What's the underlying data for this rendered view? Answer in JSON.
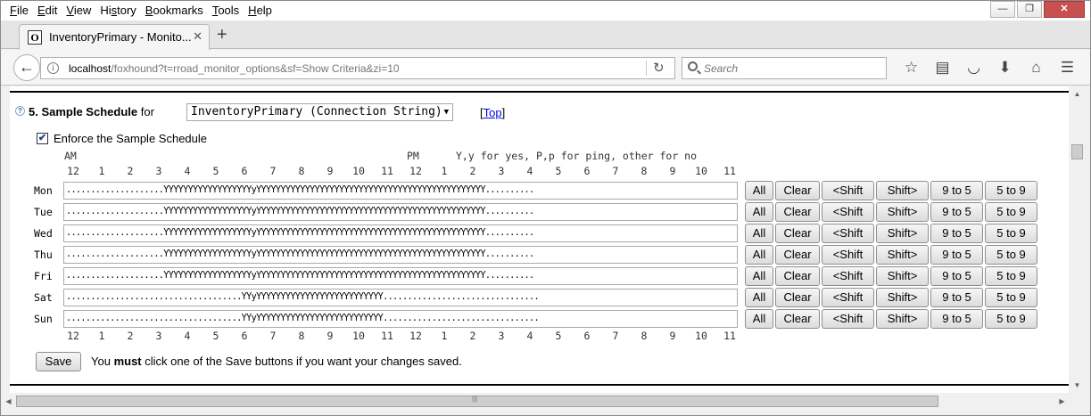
{
  "window": {
    "menu": [
      {
        "pre": "",
        "key": "F",
        "post": "ile"
      },
      {
        "pre": "",
        "key": "E",
        "post": "dit"
      },
      {
        "pre": "",
        "key": "V",
        "post": "iew"
      },
      {
        "pre": "Hi",
        "key": "s",
        "post": "tory"
      },
      {
        "pre": "",
        "key": "B",
        "post": "ookmarks"
      },
      {
        "pre": "",
        "key": "T",
        "post": "ools"
      },
      {
        "pre": "",
        "key": "H",
        "post": "elp"
      }
    ],
    "controls": {
      "minimize": "—",
      "restore": "❐",
      "close": "✕"
    }
  },
  "tabs": [
    {
      "title": "InventoryPrimary - Monito...",
      "favicon": "O",
      "close": "✕"
    }
  ],
  "newtab": "+",
  "nav": {
    "back": "←",
    "info": "i",
    "url_host": "localhost",
    "url_path": "/foxhound?t=rroad_monitor_options&sf=Show Criteria&zi=10",
    "reload": "↻",
    "search_placeholder": "Search",
    "icons": [
      {
        "name": "bookmark-star-icon",
        "glyph": "☆"
      },
      {
        "name": "reading-list-icon",
        "glyph": "▤"
      },
      {
        "name": "pocket-icon",
        "glyph": "◡"
      },
      {
        "name": "download-icon",
        "glyph": "⬇"
      },
      {
        "name": "home-icon",
        "glyph": "⌂"
      },
      {
        "name": "hamburger-menu-icon",
        "glyph": "☰"
      }
    ]
  },
  "section": {
    "help": "?",
    "number_title": "5. Sample Schedule",
    "for_label": "for",
    "dsn_selected": "InventoryPrimary (Connection String)",
    "top_bracket_open": "[",
    "top_link": "Top",
    "top_bracket_close": "]",
    "enforce_label": "Enforce the Sample Schedule",
    "enforce_checked": "✔"
  },
  "grid": {
    "am": "AM",
    "pm": "PM",
    "legend": "Y,y for yes, P,p for ping, other for no",
    "hours": [
      "12",
      "1",
      "2",
      "3",
      "4",
      "5",
      "6",
      "7",
      "8",
      "9",
      "10",
      "11",
      "12",
      "1",
      "2",
      "3",
      "4",
      "5",
      "6",
      "7",
      "8",
      "9",
      "10",
      "11"
    ],
    "days": [
      {
        "label": "Mon",
        "schedule": "....................YYYYYYYYYYYYYYYYYYyYYYYYYYYYYYYYYYYYYYYYYYYYYYYYYYYYYYYYYYYYYYYYYY.........."
      },
      {
        "label": "Tue",
        "schedule": "....................YYYYYYYYYYYYYYYYYYyYYYYYYYYYYYYYYYYYYYYYYYYYYYYYYYYYYYYYYYYYYYYYYY.........."
      },
      {
        "label": "Wed",
        "schedule": "....................YYYYYYYYYYYYYYYYYYyYYYYYYYYYYYYYYYYYYYYYYYYYYYYYYYYYYYYYYYYYYYYYYY.........."
      },
      {
        "label": "Thu",
        "schedule": "....................YYYYYYYYYYYYYYYYYYyYYYYYYYYYYYYYYYYYYYYYYYYYYYYYYYYYYYYYYYYYYYYYYY.........."
      },
      {
        "label": "Fri",
        "schedule": "....................YYYYYYYYYYYYYYYYYYyYYYYYYYYYYYYYYYYYYYYYYYYYYYYYYYYYYYYYYYYYYYYYYY.........."
      },
      {
        "label": "Sat",
        "schedule": "....................................YYyYYYYYYYYYYYYYYYYYYYYYYYYYY................................"
      },
      {
        "label": "Sun",
        "schedule": "....................................YYyYYYYYYYYYYYYYYYYYYYYYYYYYY................................"
      }
    ],
    "buttons": {
      "all": "All",
      "clear": "Clear",
      "shift_left": "<Shift",
      "shift_right": "Shift>",
      "nine_to_five": "9 to 5",
      "five_to_nine": "5 to 9"
    }
  },
  "save": {
    "button": "Save",
    "note_pre": "You ",
    "note_bold": "must",
    "note_post": " click one of the Save buttons if you want your changes saved."
  },
  "scrollbar": {
    "up": "▲",
    "down": "▼",
    "left": "◀",
    "right": "▶",
    "grip": "|||"
  }
}
